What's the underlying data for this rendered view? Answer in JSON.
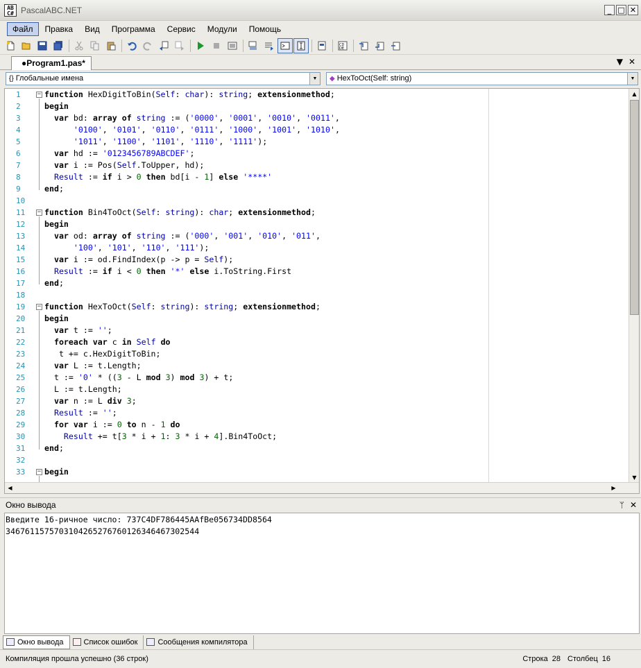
{
  "window": {
    "title": "PascalABC.NET",
    "icon_text": "AB\nC#"
  },
  "menu": [
    "Файл",
    "Правка",
    "Вид",
    "Программа",
    "Сервис",
    "Модули",
    "Помощь"
  ],
  "tab": {
    "label": "●Program1.pas*"
  },
  "dropdowns": {
    "scope": "Глобальные имена",
    "member": "HexToOct(Self: string)"
  },
  "code_lines": [
    {
      "n": "1",
      "fold": "−",
      "html": "<span class=\"kw\">function</span> HexDigitToBin(<span class=\"sf\">Self</span>: <span class=\"ty\">char</span>): <span class=\"ty\">string</span>; <span class=\"kw\">extensionmethod</span>;"
    },
    {
      "n": "2",
      "fold": "",
      "html": "<span class=\"kw\">begin</span>"
    },
    {
      "n": "3",
      "fold": "",
      "html": "  <span class=\"kw\">var</span> bd: <span class=\"kw\">array of</span> <span class=\"ty\">string</span> := (<span class=\"st\">'0000'</span>, <span class=\"st\">'0001'</span>, <span class=\"st\">'0010'</span>, <span class=\"st\">'0011'</span>,"
    },
    {
      "n": "4",
      "fold": "",
      "html": "      <span class=\"st\">'0100'</span>, <span class=\"st\">'0101'</span>, <span class=\"st\">'0110'</span>, <span class=\"st\">'0111'</span>, <span class=\"st\">'1000'</span>, <span class=\"st\">'1001'</span>, <span class=\"st\">'1010'</span>,"
    },
    {
      "n": "5",
      "fold": "",
      "html": "      <span class=\"st\">'1011'</span>, <span class=\"st\">'1100'</span>, <span class=\"st\">'1101'</span>, <span class=\"st\">'1110'</span>, <span class=\"st\">'1111'</span>);"
    },
    {
      "n": "6",
      "fold": "",
      "html": "  <span class=\"kw\">var</span> hd := <span class=\"st\">'0123456789ABCDEF'</span>;"
    },
    {
      "n": "7",
      "fold": "",
      "html": "  <span class=\"kw\">var</span> i := Pos(<span class=\"sf\">Self</span>.ToUpper, hd);"
    },
    {
      "n": "8",
      "fold": "",
      "html": "  <span class=\"sf\">Result</span> := <span class=\"kw\">if</span> i &gt; <span class=\"nm\">0</span> <span class=\"kw\">then</span> bd[i - <span class=\"nm\">1</span>] <span class=\"kw\">else</span> <span class=\"st\">'****'</span>"
    },
    {
      "n": "9",
      "fold": "",
      "html": "<span class=\"kw\">end</span>;"
    },
    {
      "n": "10",
      "fold": "",
      "html": ""
    },
    {
      "n": "11",
      "fold": "−",
      "html": "<span class=\"kw\">function</span> Bin4ToOct(<span class=\"sf\">Self</span>: <span class=\"ty\">string</span>): <span class=\"ty\">char</span>; <span class=\"kw\">extensionmethod</span>;"
    },
    {
      "n": "12",
      "fold": "",
      "html": "<span class=\"kw\">begin</span>"
    },
    {
      "n": "13",
      "fold": "",
      "html": "  <span class=\"kw\">var</span> od: <span class=\"kw\">array of</span> <span class=\"ty\">string</span> := (<span class=\"st\">'000'</span>, <span class=\"st\">'001'</span>, <span class=\"st\">'010'</span>, <span class=\"st\">'011'</span>,"
    },
    {
      "n": "14",
      "fold": "",
      "html": "      <span class=\"st\">'100'</span>, <span class=\"st\">'101'</span>, <span class=\"st\">'110'</span>, <span class=\"st\">'111'</span>);"
    },
    {
      "n": "15",
      "fold": "",
      "html": "  <span class=\"kw\">var</span> i := od.FindIndex(p -&gt; p = <span class=\"sf\">Self</span>);"
    },
    {
      "n": "16",
      "fold": "",
      "html": "  <span class=\"sf\">Result</span> := <span class=\"kw\">if</span> i &lt; <span class=\"nm\">0</span> <span class=\"kw\">then</span> <span class=\"st\">'*'</span> <span class=\"kw\">else</span> i.ToString.First"
    },
    {
      "n": "17",
      "fold": "",
      "html": "<span class=\"kw\">end</span>;"
    },
    {
      "n": "18",
      "fold": "",
      "html": ""
    },
    {
      "n": "19",
      "fold": "−",
      "html": "<span class=\"kw\">function</span> HexToOct(<span class=\"sf\">Self</span>: <span class=\"ty\">string</span>): <span class=\"ty\">string</span>; <span class=\"kw\">extensionmethod</span>;"
    },
    {
      "n": "20",
      "fold": "",
      "html": "<span class=\"kw\">begin</span>"
    },
    {
      "n": "21",
      "fold": "",
      "html": "  <span class=\"kw\">var</span> t := <span class=\"st\">''</span>;"
    },
    {
      "n": "22",
      "fold": "",
      "html": "  <span class=\"kw\">foreach var</span> c <span class=\"kw\">in</span> <span class=\"sf\">Self</span> <span class=\"kw\">do</span>"
    },
    {
      "n": "23",
      "fold": "",
      "html": "   t += c.HexDigitToBin;"
    },
    {
      "n": "24",
      "fold": "",
      "html": "  <span class=\"kw\">var</span> L := t.Length;"
    },
    {
      "n": "25",
      "fold": "",
      "html": "  t := <span class=\"st\">'0'</span> * ((<span class=\"nm\">3</span> - L <span class=\"kw\">mod</span> <span class=\"nm\">3</span>) <span class=\"kw\">mod</span> <span class=\"nm\">3</span>) + t;"
    },
    {
      "n": "26",
      "fold": "",
      "html": "  L := t.Length;"
    },
    {
      "n": "27",
      "fold": "",
      "html": "  <span class=\"kw\">var</span> n := L <span class=\"kw\">div</span> <span class=\"nm\">3</span>;"
    },
    {
      "n": "28",
      "fold": "",
      "html": "  <span class=\"sf\">Result</span> := <span class=\"st\">''</span>;"
    },
    {
      "n": "29",
      "fold": "",
      "html": "  <span class=\"kw\">for var</span> i := <span class=\"nm\">0</span> <span class=\"kw\">to</span> n - <span class=\"nm\">1</span> <span class=\"kw\">do</span>"
    },
    {
      "n": "30",
      "fold": "",
      "html": "    <span class=\"sf\">Result</span> += t[<span class=\"nm\">3</span> * i + <span class=\"nm\">1</span>: <span class=\"nm\">3</span> * i + <span class=\"nm\">4</span>].Bin4ToOct;"
    },
    {
      "n": "31",
      "fold": "",
      "html": "<span class=\"kw\">end</span>;"
    },
    {
      "n": "32",
      "fold": "",
      "html": ""
    },
    {
      "n": "33",
      "fold": "−",
      "html": "<span class=\"kw\">begin</span>"
    }
  ],
  "output": {
    "title": "Окно вывода",
    "lines": [
      "Введите 16-ричное число: 737C4DF786445AAfBe056734DD8564",
      "3467611575703104265276760126346467302544"
    ]
  },
  "bottom_tabs": [
    "Окно вывода",
    "Список ошибок",
    "Сообщения компилятора"
  ],
  "status": {
    "message": "Компиляция прошла успешно (36 строк)",
    "row_label": "Строка",
    "row": "28",
    "col_label": "Столбец",
    "col": "16"
  }
}
